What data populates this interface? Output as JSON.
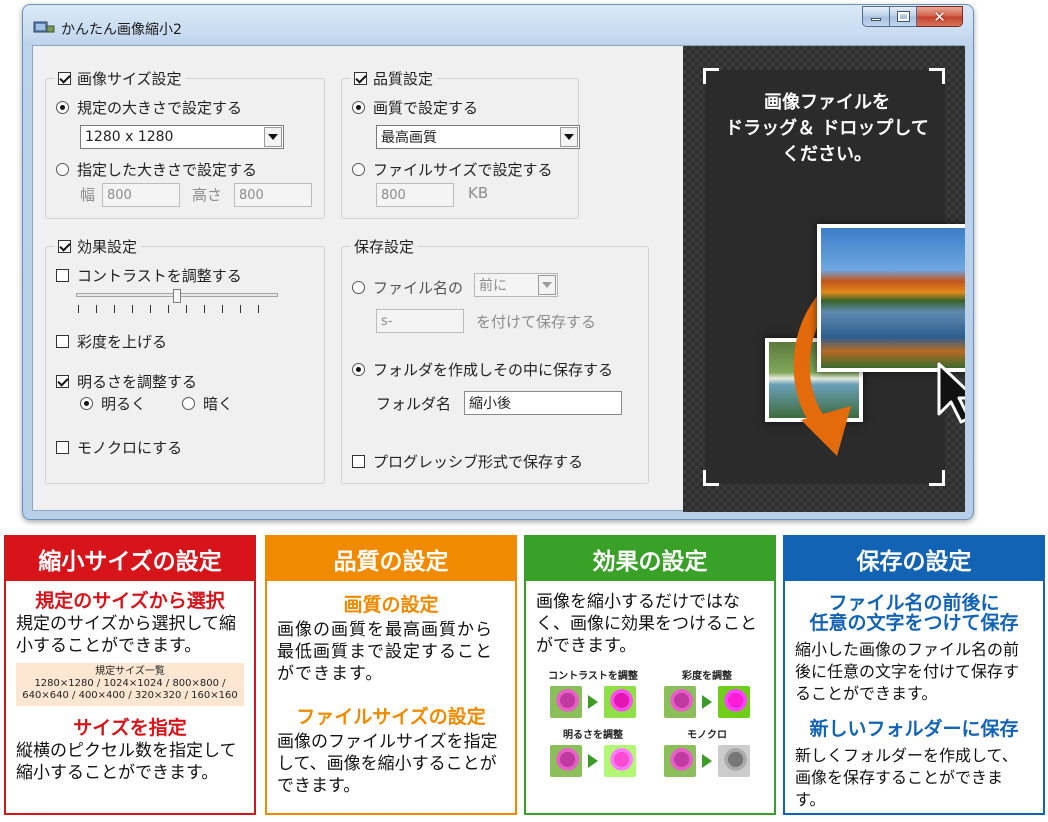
{
  "window": {
    "title": "かんたん画像縮小2"
  },
  "size_group": {
    "label": "画像サイズ設定",
    "preset_option": "規定の大きさで設定する",
    "preset_value": "1280 x 1280",
    "custom_option": "指定した大きさで設定する",
    "width_label": "幅",
    "width_value": "800",
    "height_label": "高さ",
    "height_value": "800"
  },
  "quality_group": {
    "label": "品質設定",
    "quality_option": "画質で設定する",
    "quality_value": "最高画質",
    "filesize_option": "ファイルサイズで設定する",
    "filesize_value": "800",
    "filesize_unit": "KB"
  },
  "effect_group": {
    "label": "効果設定",
    "contrast": "コントラストを調整する",
    "saturation": "彩度を上げる",
    "brightness": "明るさを調整する",
    "bright_option": "明るく",
    "dark_option": "暗く",
    "mono": "モノクロにする"
  },
  "save_group": {
    "label": "保存設定",
    "filename_option": "ファイル名の",
    "position_value": "前に",
    "prefix_value": "s-",
    "prefix_suffix": "を付けて保存する",
    "folder_option": "フォルダを作成しその中に保存する",
    "folder_label": "フォルダ名",
    "folder_value": "縮小後",
    "progressive": "プログレッシブ形式で保存する"
  },
  "dropzone": {
    "line1": "画像ファイルを",
    "line2": "ドラッグ＆ ドロップして",
    "line3": "ください。"
  },
  "panels": {
    "size": {
      "title": "縮小サイズの設定",
      "sub1": "規定のサイズから選択",
      "text1": "規定のサイズから選択して縮小することができます。",
      "list_title": "規定サイズ一覧",
      "list_line1": "1280×1280 / 1024×1024 / 800×800 /",
      "list_line2": "640×640 / 400×400 / 320×320 / 160×160",
      "sub2": "サイズを指定",
      "text2": "縦横のピクセル数を指定して縮小することができます。"
    },
    "quality": {
      "title": "品質の設定",
      "sub1": "画質の設定",
      "text1": "画像の画質を最高画質から最低画質まで設定することができます。",
      "sub2": "ファイルサイズの設定",
      "text2": "画像のファイルサイズを指定して、画像を縮小することができます。"
    },
    "effect": {
      "title": "効果の設定",
      "text1": "画像を縮小するだけではなく、画像に効果をつけることができます。",
      "ex1": "コントラストを調整",
      "ex2": "彩度を調整",
      "ex3": "明るさを調整",
      "ex4": "モノクロ"
    },
    "save": {
      "title": "保存の設定",
      "sub1_line1": "ファイル名の前後に",
      "sub1_line2": "任意の文字をつけて保存",
      "text1": "縮小した画像のファイル名の前後に任意の文字を付けて保存することができます。",
      "sub2": "新しいフォルダーに保存",
      "text2": "新しくフォルダーを作成して、画像を保存することができます。"
    }
  },
  "colors": {
    "red": "#d7141a",
    "orange": "#f08a00",
    "green": "#3aa128",
    "blue": "#1363b4"
  }
}
